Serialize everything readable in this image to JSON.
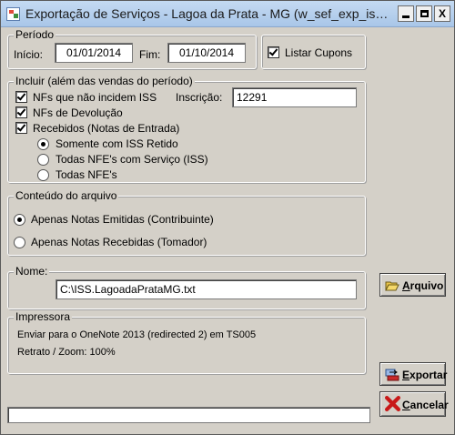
{
  "window": {
    "title": "Exportação de Serviços - Lagoa da Prata - MG (w_sef_exp_iss_lagoadaprata)",
    "controls": {
      "minimize": "_",
      "maximize": "□",
      "close": "X"
    }
  },
  "periodo": {
    "legend": "Período",
    "inicio_label": "Início:",
    "inicio_value": "01/01/2014",
    "fim_label": "Fim:",
    "fim_value": "01/10/2014"
  },
  "listar_cupons": {
    "label": "Listar Cupons",
    "checked": true
  },
  "incluir": {
    "legend": "Incluir (além das vendas do período)",
    "nfs_iss_label": "NFs que não incidem ISS",
    "inscricao_label": "Inscrição:",
    "inscricao_value": "12291",
    "nfs_devolucao_label": "NFs de Devolução",
    "recebidos_label": "Recebidos (Notas de Entrada)",
    "options": [
      {
        "label": "Somente com ISS Retido",
        "selected": true
      },
      {
        "label": "Todas NFE's com Serviço (ISS)",
        "selected": false
      },
      {
        "label": "Todas NFE's",
        "selected": false
      }
    ]
  },
  "conteudo": {
    "legend": "Conteúdo do arquivo",
    "options": [
      {
        "label": "Apenas Notas Emitidas (Contribuinte)",
        "selected": true
      },
      {
        "label": "Apenas Notas Recebidas (Tomador)",
        "selected": false
      }
    ]
  },
  "nome": {
    "legend": "Nome:",
    "value": "C:\\ISS.LagoadaPrataMG.txt"
  },
  "impressora": {
    "legend": "Impressora",
    "line1": "Enviar para o OneNote 2013 (redirected 2) em TS005",
    "line2": "Retrato / Zoom: 100%"
  },
  "buttons": {
    "arquivo": {
      "underline": "A",
      "rest": "rquivo"
    },
    "exportar": {
      "underline": "E",
      "rest": "xportar"
    },
    "cancelar": {
      "underline": "C",
      "rest": "ancelar"
    }
  },
  "icons": {
    "app": "app-icon",
    "arquivo": "folder-open-icon",
    "exportar": "export-icon",
    "cancelar": "red-x-icon"
  }
}
